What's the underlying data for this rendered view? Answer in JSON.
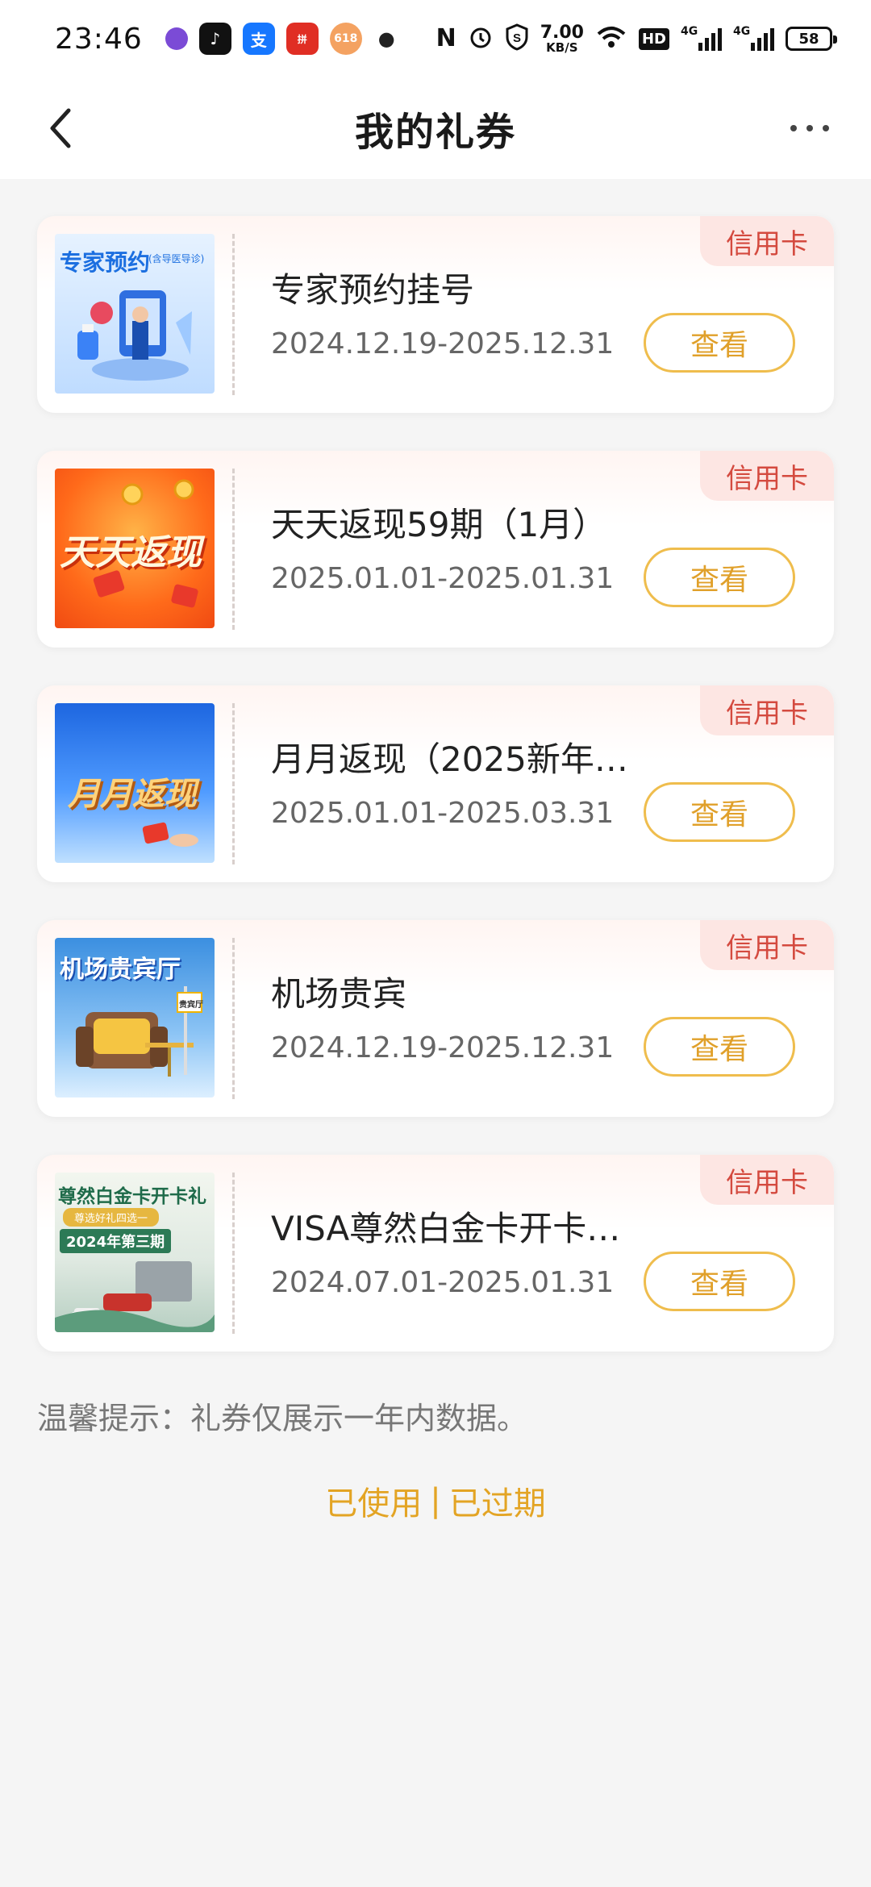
{
  "status_bar": {
    "time": "23:46",
    "speed_value": "7.00",
    "speed_unit": "KB/S",
    "hd_label": "HD",
    "signal_label_1": "4G",
    "signal_label_2": "4G",
    "battery": "58"
  },
  "nav": {
    "title": "我的礼券"
  },
  "coupons": [
    {
      "title": "专家预约挂号",
      "date": "2024.12.19-2025.12.31",
      "tag": "信用卡",
      "button": "查看",
      "thumb_text": "专家预约",
      "thumb_subtext": "(含导医导诊)"
    },
    {
      "title": "天天返现59期（1月）",
      "date": "2025.01.01-2025.01.31",
      "tag": "信用卡",
      "button": "查看",
      "thumb_text": "天天返现"
    },
    {
      "title": "月月返现（2025新年…",
      "date": "2025.01.01-2025.03.31",
      "tag": "信用卡",
      "button": "查看",
      "thumb_text": "月月返现"
    },
    {
      "title": "机场贵宾",
      "date": "2024.12.19-2025.12.31",
      "tag": "信用卡",
      "button": "查看",
      "thumb_text": "机场贵宾厅",
      "thumb_subtext": "贵宾厅"
    },
    {
      "title": "VISA尊然白金卡开卡…",
      "date": "2024.07.01-2025.01.31",
      "tag": "信用卡",
      "button": "查看",
      "thumb_text": "尊然白金卡开卡礼",
      "thumb_subtext": "尊选好礼四选一",
      "thumb_subtext2": "2024年第三期"
    }
  ],
  "tip": "温馨提示：礼券仅展示一年内数据。",
  "footer": {
    "used": "已使用",
    "separator": "|",
    "expired": "已过期"
  }
}
